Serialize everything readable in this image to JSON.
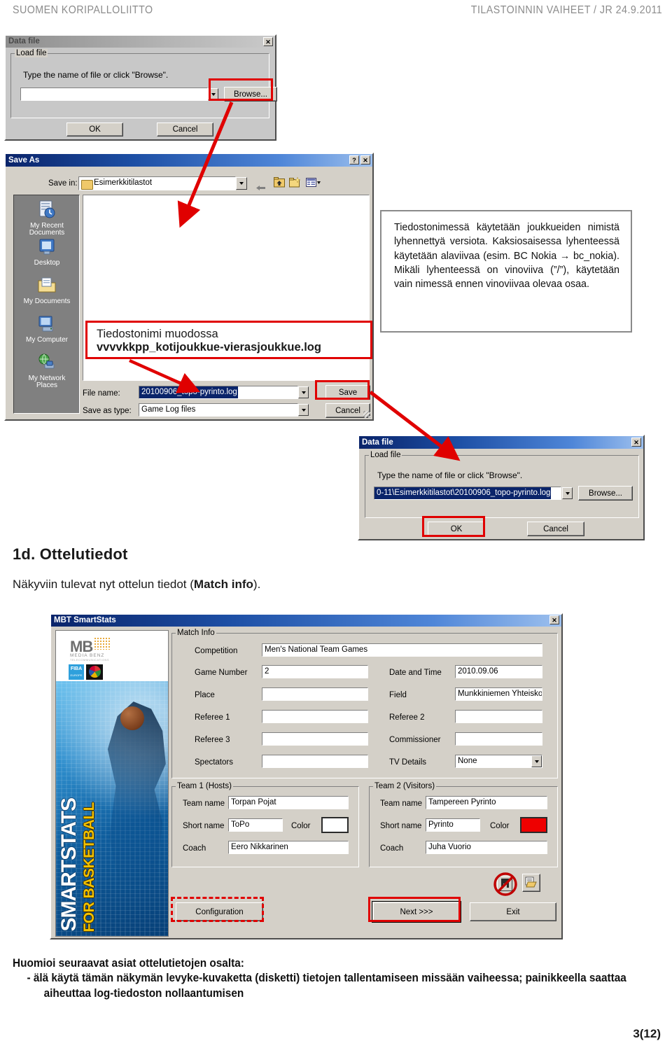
{
  "header": {
    "left": "SUOMEN KORIPALLOLIITTO",
    "right": "TILASTOINNIN VAIHEET / JR  24.9.2011"
  },
  "datafile_dialog_1": {
    "title": "Data file",
    "close_label": "✕",
    "group_legend": "Load file",
    "instruction": "Type the name of file or click \"Browse\".",
    "path_value": "",
    "browse_label": "Browse...",
    "ok_label": "OK",
    "cancel_label": "Cancel"
  },
  "saveas_dialog": {
    "title": "Save As",
    "help_label": "?",
    "close_label": "✕",
    "save_in_label": "Save in:",
    "save_in_value": "Esimerkkitilastot",
    "toolbar_icons": [
      "back-icon",
      "up-one-level-icon",
      "new-folder-icon",
      "views-icon"
    ],
    "places": [
      {
        "label": "My Recent\nDocuments",
        "icon": "recent-documents-icon"
      },
      {
        "label": "Desktop",
        "icon": "desktop-icon"
      },
      {
        "label": "My Documents",
        "icon": "my-documents-icon"
      },
      {
        "label": "My Computer",
        "icon": "my-computer-icon"
      },
      {
        "label": "My Network\nPlaces",
        "icon": "network-places-icon"
      }
    ],
    "file_name_label": "File name:",
    "file_name_value": "20100906_topo-pyrinto.log",
    "save_as_type_label": "Save as type:",
    "save_as_type_value": "Game Log files",
    "save_label": "Save",
    "cancel_label": "Cancel"
  },
  "callout_filename": {
    "line1": "Tiedostonimi muodossa",
    "line2": "vvvvkkpp_kotijoukkue-vierasjoukkue.log"
  },
  "infobox": {
    "text": "Tiedostonimessä käytetään joukkueiden nimistä lyhennettyä versiota. Kaksiosaisessa lyhenteessä käytetään alaviivaa (esim. BC Nokia → bc_nokia). Mikäli lyhenteessä on vinoviiva (”/”), käytetään vain nimessä ennen vinoviivaa olevaa osaa."
  },
  "datafile_dialog_2": {
    "title": "Data file",
    "close_label": "✕",
    "group_legend": "Load file",
    "instruction": "Type the name of file or click \"Browse\".",
    "path_value": "0-11\\Esimerkkitilastot\\20100906_topo-pyrinto.log",
    "browse_label": "Browse...",
    "ok_label": "OK",
    "cancel_label": "Cancel"
  },
  "section": {
    "heading": "1d. Ottelutiedot",
    "body_before": "Näkyviin tulevat nyt ottelun tiedot (",
    "body_bold": "Match info",
    "body_after": ")."
  },
  "mbt_window": {
    "title": "MBT SmartStats",
    "close_label": "✕",
    "splash": {
      "brand": "MB",
      "brand_sub": "MEDIA BENZ",
      "brand_sub2": "TELECOMMUNICATIONS",
      "fiba": "FIBA",
      "fiba_sub": "EUROPE",
      "vertical_main": "SMARTSTATS",
      "vertical_sub": "FOR BASKETBALL"
    },
    "match_info": {
      "legend": "Match Info",
      "fields": [
        {
          "label": "Competition",
          "value": "Men's National Team Games"
        },
        {
          "label": "Game Number",
          "value": "2"
        },
        {
          "label": "Date and Time",
          "value": "2010.09.06"
        },
        {
          "label": "Place",
          "value": ""
        },
        {
          "label": "Field",
          "value": "Munkkiniemen Yhteiskoulu"
        },
        {
          "label": "Referee 1",
          "value": ""
        },
        {
          "label": "Referee 2",
          "value": ""
        },
        {
          "label": "Referee 3",
          "value": ""
        },
        {
          "label": "Commissioner",
          "value": ""
        },
        {
          "label": "Spectators",
          "value": ""
        },
        {
          "label": "TV Details",
          "value": "None"
        }
      ]
    },
    "team1": {
      "legend": "Team 1 (Hosts)",
      "team_name_label": "Team name",
      "team_name_value": "Torpan Pojat",
      "short_name_label": "Short name",
      "short_name_value": "ToPo",
      "color_label": "Color",
      "color_value": "#ffffff",
      "coach_label": "Coach",
      "coach_value": "Eero  Nikkarinen"
    },
    "team2": {
      "legend": "Team 2 (Visitors)",
      "team_name_label": "Team name",
      "team_name_value": "Tampereen Pyrinto",
      "short_name_label": "Short name",
      "short_name_value": "Pyrinto",
      "color_label": "Color",
      "color_value": "#ee0000",
      "coach_label": "Coach",
      "coach_value": "Juha Vuorio"
    },
    "buttons": {
      "configuration": "Configuration",
      "next": "Next >>>",
      "exit": "Exit"
    },
    "icons": {
      "save_disabled": "save-disabled-icon",
      "open": "open-folder-icon"
    }
  },
  "footer": {
    "intro": "Huomioi seuraavat asiat ottelutietojen osalta:",
    "bullet": "-   älä käytä tämän näkymän levyke-kuvaketta (disketti) tietojen tallentamiseen missään vaiheessa; painikkeella saattaa aiheuttaa log-tiedoston nollaantumisen",
    "page_number": "3(12)"
  },
  "colors": {
    "annotation_red": "#e00000",
    "title_blue": "#0a246a",
    "dialog_face": "#d4d0c8"
  }
}
